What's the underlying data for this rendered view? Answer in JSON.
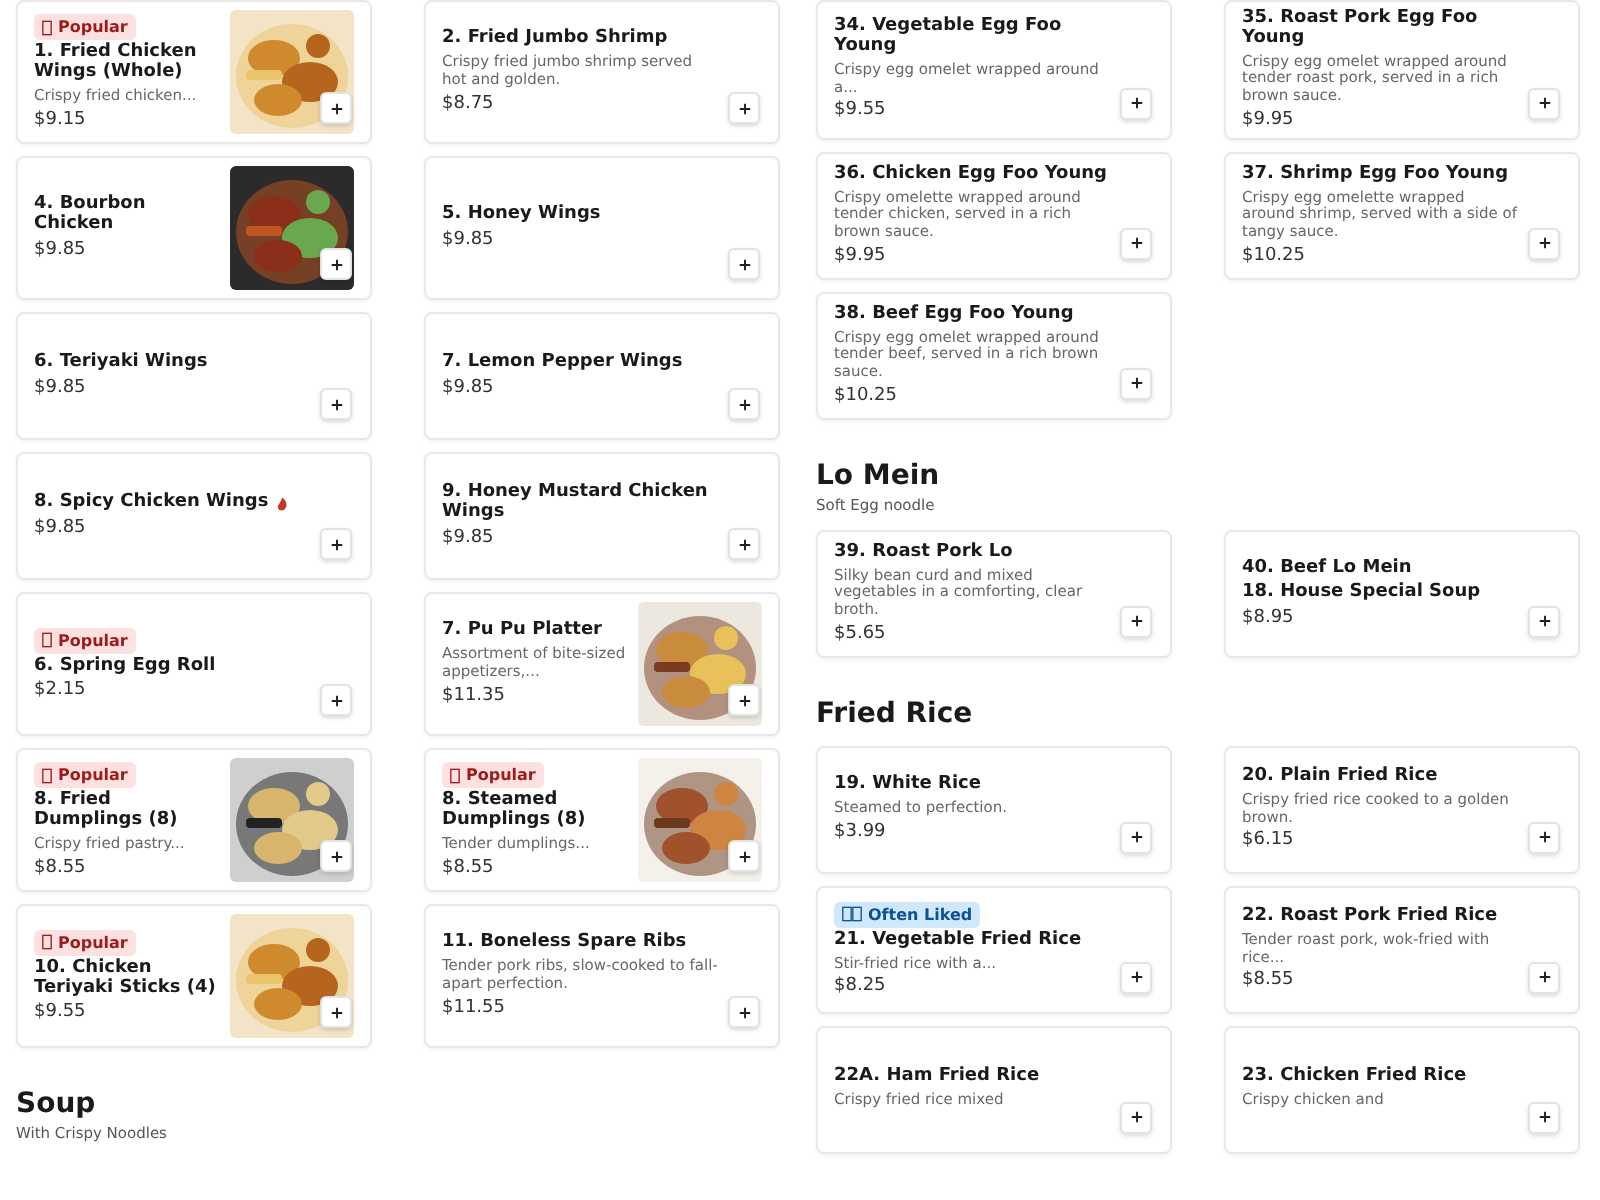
{
  "columns": [
    {
      "blocks": [
        {
          "kind": "grid",
          "items": [
            {
              "title": "1. Fried Chicken Wings (Whole)",
              "badge": {
                "kind": "popular",
                "label": "Popular"
              },
              "description": "Crispy fried chicken...",
              "price": "$9.15",
              "photo": true
            },
            {
              "title": "2. Fried Jumbo Shrimp",
              "description": "Crispy fried jumbo shrimp served hot and golden.",
              "price": "$8.75",
              "photo": false
            }
          ]
        },
        {
          "kind": "grid",
          "items": [
            {
              "title": "4. Bourbon Chicken",
              "price": "$9.85",
              "photo": true
            },
            {
              "title": "5. Honey Wings",
              "price": "$9.85",
              "photo": false
            }
          ]
        },
        {
          "kind": "grid",
          "items": [
            {
              "title": "6. Teriyaki Wings",
              "price": "$9.85",
              "photo": false
            },
            {
              "title": "7. Lemon Pepper Wings",
              "price": "$9.85",
              "photo": false
            }
          ]
        },
        {
          "kind": "grid",
          "items": [
            {
              "title": "8. Spicy Chicken Wings",
              "spicy": true,
              "price": "$9.85",
              "photo": false
            },
            {
              "title": "9. Honey Mustard Chicken Wings",
              "price": "$9.85",
              "photo": false
            }
          ]
        },
        {
          "kind": "grid",
          "items": [
            {
              "title": "6. Spring Egg Roll",
              "badge": {
                "kind": "popular",
                "label": "Popular"
              },
              "price": "$2.15",
              "photo": false
            },
            {
              "title": "7. Pu Pu Platter",
              "description": "Assortment of bite-sized appetizers,...",
              "price": "$11.35",
              "photo": true
            }
          ]
        },
        {
          "kind": "grid",
          "items": [
            {
              "title": "8. Fried Dumplings (8)",
              "badge": {
                "kind": "popular",
                "label": "Popular"
              },
              "description": "Crispy fried pastry...",
              "price": "$8.55",
              "photo": true
            },
            {
              "title": "8. Steamed Dumplings (8)",
              "badge": {
                "kind": "popular",
                "label": "Popular"
              },
              "description": "Tender dumplings...",
              "price": "$8.55",
              "photo": true
            }
          ]
        },
        {
          "kind": "grid",
          "items": [
            {
              "title": "10. Chicken Teriyaki Sticks (4)",
              "badge": {
                "kind": "popular",
                "label": "Popular"
              },
              "price": "$9.55",
              "photo": true
            },
            {
              "title": "11. Boneless Spare Ribs",
              "description": "Tender pork ribs, slow-cooked to fall-apart perfection.",
              "price": "$11.55",
              "photo": false
            }
          ]
        },
        {
          "kind": "section",
          "title": "Soup",
          "subtitle": "With Crispy Noodles"
        }
      ]
    },
    {
      "blocks": [
        {
          "kind": "grid",
          "items": [
            {
              "title": "34. Vegetable Egg Foo Young",
              "description": "Crispy egg omelet wrapped around a...",
              "price": "$9.55",
              "photo": false
            },
            {
              "title": "35. Roast Pork Egg Foo Young",
              "description": "Crispy egg omelet wrapped around tender roast pork, served in a rich brown sauce.",
              "price": "$9.95",
              "photo": false
            }
          ]
        },
        {
          "kind": "grid",
          "items": [
            {
              "title": "36. Chicken Egg Foo Young",
              "description": "Crispy omelette wrapped around tender chicken, served in a rich brown sauce.",
              "price": "$9.95",
              "photo": false
            },
            {
              "title": "37. Shrimp Egg Foo Young",
              "description": "Crispy egg omelette wrapped around shrimp, served with a side of tangy sauce.",
              "price": "$10.25",
              "photo": false
            }
          ]
        },
        {
          "kind": "grid",
          "items": [
            {
              "title": "38. Beef Egg Foo Young",
              "description": "Crispy egg omelet wrapped around tender beef, served in a rich brown sauce.",
              "price": "$10.25",
              "photo": false
            }
          ]
        },
        {
          "kind": "section",
          "title": "Lo Mein",
          "subtitle": "Soft Egg noodle"
        },
        {
          "kind": "grid",
          "items": [
            {
              "title": "39. Roast Pork Lo",
              "description": "Silky bean curd and mixed vegetables in a comforting, clear broth.",
              "price": "$5.65",
              "photo": false
            },
            {
              "title": "40. Beef Lo Mein",
              "second_title": "18. House Special Soup",
              "price": "$8.95",
              "photo": false
            }
          ]
        },
        {
          "kind": "section",
          "title": "Fried Rice"
        },
        {
          "kind": "grid",
          "items": [
            {
              "title": "19. White Rice",
              "description": "Steamed to perfection.",
              "price": "$3.99",
              "photo": false
            },
            {
              "title": "20. Plain Fried Rice",
              "description": "Crispy fried rice cooked to a golden brown.",
              "price": "$6.15",
              "photo": false
            }
          ]
        },
        {
          "kind": "grid",
          "items": [
            {
              "title": "21. Vegetable Fried Rice",
              "badge": {
                "kind": "liked",
                "label": "Often Liked"
              },
              "description": "Stir-fried rice with a...",
              "price": "$8.25",
              "photo": false
            },
            {
              "title": "22. Roast Pork Fried Rice",
              "description": "Tender roast pork, wok-fried with rice...",
              "price": "$8.55",
              "photo": false
            }
          ]
        },
        {
          "kind": "grid",
          "items": [
            {
              "title": "22A. Ham Fried Rice",
              "description": "Crispy fried rice mixed",
              "photo": false
            },
            {
              "title": "23. Chicken Fried Rice",
              "description": "Crispy chicken and",
              "photo": false
            }
          ]
        }
      ]
    }
  ]
}
